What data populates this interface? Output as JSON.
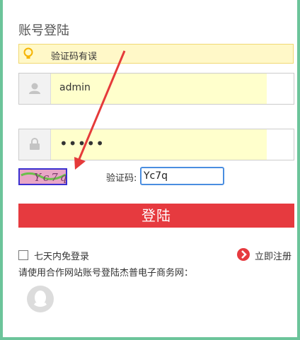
{
  "login": {
    "title": "账号登陆",
    "error_message": "验证码有误",
    "username_value": "admin",
    "password_value": "•••••",
    "captcha_image_text": "Yc7q",
    "captcha_label": "验证码:",
    "captcha_value": "Yc7q",
    "submit_label": "登陆",
    "remember_label": "七天内免登录",
    "register_label": "立即注册",
    "partner_text": "请使用合作网站账号登陆杰普电子商务网："
  },
  "colors": {
    "accent_red": "#e63a3f",
    "error_bg": "#fff8c8",
    "focus_blue": "#4a8ee0",
    "page_bg": "#6cc49a"
  },
  "icons": [
    "bulb-icon",
    "user-icon",
    "lock-icon",
    "arrow-right-icon",
    "qq-icon"
  ]
}
